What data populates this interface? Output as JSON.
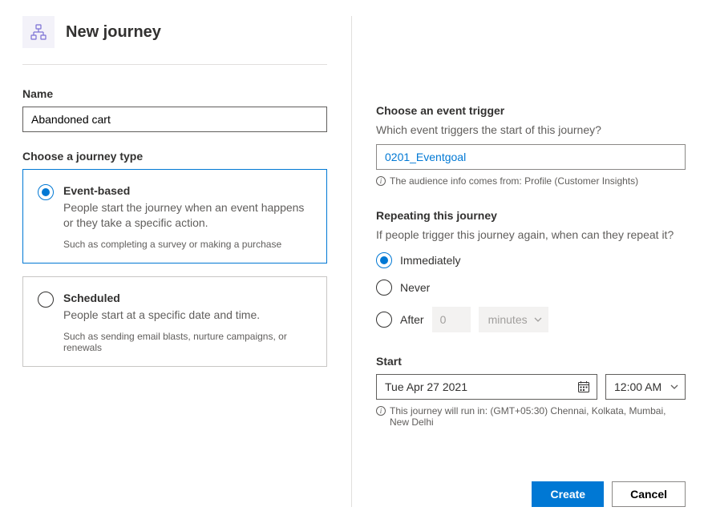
{
  "header": {
    "title": "New journey"
  },
  "name": {
    "label": "Name",
    "value": "Abandoned cart"
  },
  "journeyType": {
    "label": "Choose a journey type",
    "options": [
      {
        "title": "Event-based",
        "desc": "People start the journey when an event happens or they take a specific action.",
        "example": "Such as completing a survey or making a purchase",
        "selected": true
      },
      {
        "title": "Scheduled",
        "desc": "People start at a specific date and time.",
        "example": "Such as sending email blasts, nurture campaigns, or renewals",
        "selected": false
      }
    ]
  },
  "eventTrigger": {
    "label": "Choose an event trigger",
    "desc": "Which event triggers the start of this journey?",
    "value": "0201_Eventgoal",
    "info": "The audience info comes from: Profile (Customer Insights)"
  },
  "repeat": {
    "label": "Repeating this journey",
    "desc": "If people trigger this journey again, when can they repeat it?",
    "options": {
      "immediately": "Immediately",
      "never": "Never",
      "after": "After"
    },
    "afterValue": "0",
    "afterUnit": "minutes"
  },
  "start": {
    "label": "Start",
    "date": "Tue Apr 27 2021",
    "time": "12:00 AM",
    "info": "This journey will run in: (GMT+05:30) Chennai, Kolkata, Mumbai, New Delhi"
  },
  "footer": {
    "create": "Create",
    "cancel": "Cancel"
  }
}
